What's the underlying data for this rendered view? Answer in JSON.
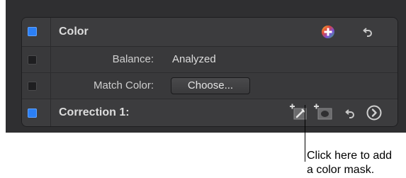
{
  "color_section": {
    "title": "Color",
    "enabled": true,
    "icons": [
      "add-effect-icon",
      "reset-icon"
    ]
  },
  "balance": {
    "label": "Balance:",
    "value": "Analyzed",
    "enabled": false
  },
  "match_color": {
    "label": "Match Color:",
    "button_label": "Choose...",
    "enabled": false
  },
  "correction": {
    "title": "Correction 1:",
    "enabled": true,
    "icons": [
      "add-color-mask-icon",
      "add-shape-mask-icon",
      "reset-icon",
      "show-details-icon"
    ]
  },
  "callout": {
    "line1": "Click here to add",
    "line2": "a color mask."
  },
  "colors": {
    "accent_blue": "#2b7ff5",
    "panel_bg": "#3a3a3c",
    "text": "#dddddd"
  }
}
